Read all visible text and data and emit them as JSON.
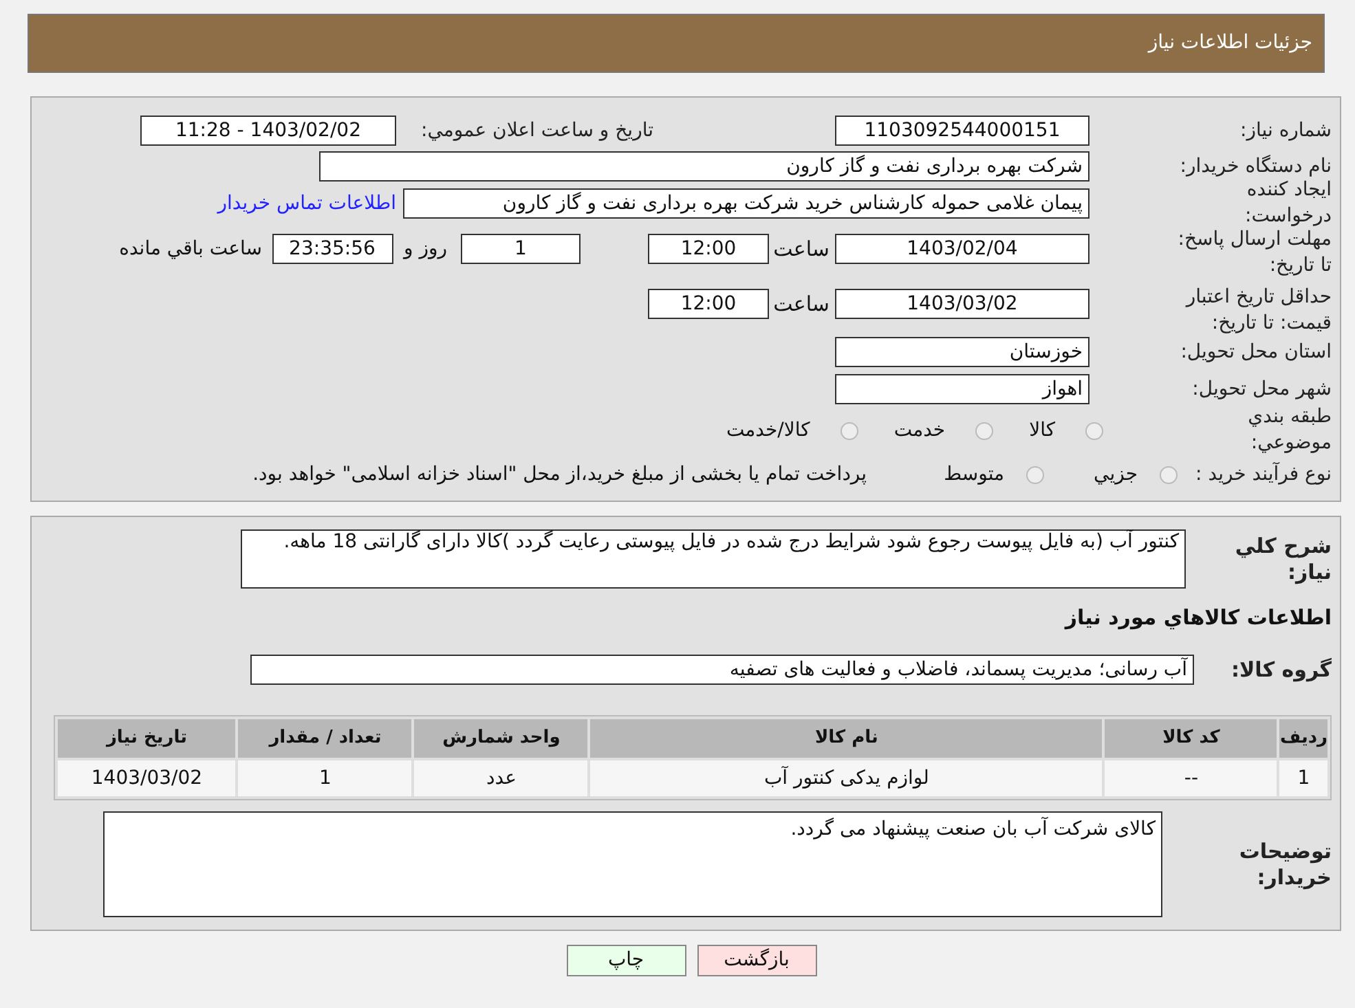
{
  "header": {
    "title": "جزئیات اطلاعات نیاز"
  },
  "need_number": {
    "label": "شماره نياز:",
    "value": "1103092544000151"
  },
  "announce": {
    "label": "تاريخ و ساعت اعلان عمومي:",
    "value": "1403/02/02 - 11:28"
  },
  "buyer_org": {
    "label": "نام دستگاه خريدار:",
    "value": "شرکت بهره برداری نفت و گاز کارون"
  },
  "requester": {
    "label": "ايجاد کننده درخواست:",
    "value": "پیمان غلامی حموله کارشناس خرید شرکت بهره برداری نفت و گاز کارون",
    "link": "اطلاعات تماس خريدار"
  },
  "reply_deadline": {
    "label": "مهلت ارسال پاسخ: تا تاريخ:",
    "date": "1403/02/04",
    "time_label": "ساعت",
    "time": "12:00",
    "days": "1",
    "days_label": "روز و",
    "remaining": "23:35:56",
    "remaining_label": "ساعت باقي مانده"
  },
  "price_validity": {
    "label": "حداقل تاريخ اعتبار قيمت: تا تاريخ:",
    "date": "1403/03/02",
    "time_label": "ساعت",
    "time": "12:00"
  },
  "province": {
    "label": "استان محل تحويل:",
    "value": "خوزستان"
  },
  "city": {
    "label": "شهر محل تحويل:",
    "value": "اهواز"
  },
  "category": {
    "label": "طبقه بندي موضوعي:",
    "options": [
      {
        "label": "کالا",
        "selected": false
      },
      {
        "label": "خدمت",
        "selected": false
      },
      {
        "label": "کالا/خدمت",
        "selected": false
      }
    ]
  },
  "process": {
    "label": "نوع فرآيند خريد :",
    "options": [
      {
        "label": "جزيي",
        "selected": false
      },
      {
        "label": "متوسط",
        "selected": false
      }
    ],
    "note": "پرداخت تمام یا بخشی از مبلغ خرید،از محل \"اسناد خزانه اسلامی\" خواهد بود."
  },
  "description": {
    "label": "شرح کلي نياز:",
    "value": "کنتور آب (به فایل پیوست رجوع شود شرایط درج شده در فایل پیوستی رعایت گردد )کالا دارای گارانتی 18 ماهه."
  },
  "goods_title": "اطلاعات کالاهاي مورد نياز",
  "goods_group": {
    "label": "گروه کالا:",
    "value": "آب رسانی؛ مدیریت پسماند، فاضلاب و فعالیت های تصفیه"
  },
  "table": {
    "columns": [
      "رديف",
      "کد کالا",
      "نام کالا",
      "واحد شمارش",
      "تعداد / مقدار",
      "تاريخ نياز"
    ],
    "rows": [
      [
        "1",
        "--",
        "لوازم یدکی کنتور آب",
        "عدد",
        "1",
        "1403/03/02"
      ]
    ]
  },
  "buyer_notes": {
    "label": "توضيحات خريدار:",
    "value": "کالای شرکت آب بان صنعت پیشنهاد می گردد."
  },
  "buttons": [
    {
      "kind": "back",
      "label": "بازگشت"
    },
    {
      "kind": "print",
      "label": "چاپ"
    }
  ]
}
